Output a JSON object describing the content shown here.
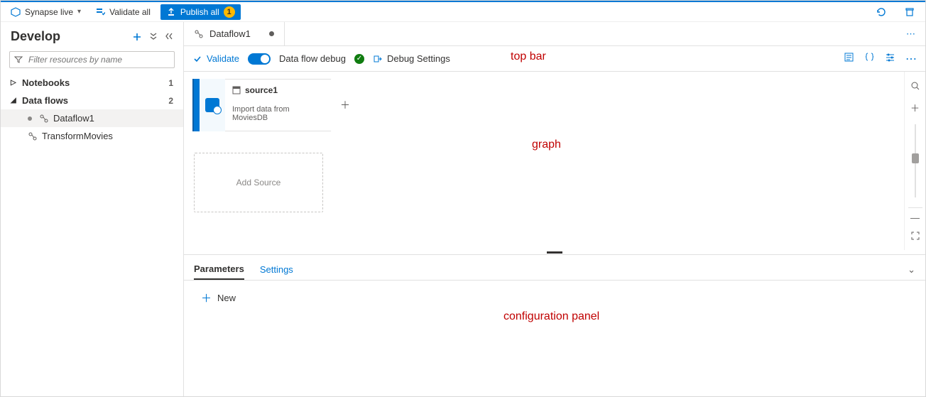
{
  "commandBar": {
    "branding": "Synapse live",
    "validateAll": "Validate all",
    "publishAll": "Publish all",
    "publishCount": "1"
  },
  "sidebar": {
    "title": "Develop",
    "filterPlaceholder": "Filter resources by name",
    "groups": [
      {
        "label": "Notebooks",
        "count": "1",
        "expanded": false
      },
      {
        "label": "Data flows",
        "count": "2",
        "expanded": true
      }
    ],
    "items": [
      {
        "label": "Dataflow1",
        "active": true,
        "modified": true
      },
      {
        "label": "TransformMovies",
        "active": false,
        "modified": false
      }
    ]
  },
  "tab": {
    "label": "Dataflow1"
  },
  "toolbar": {
    "validate": "Validate",
    "debugLabel": "Data flow debug",
    "debugSettings": "Debug Settings"
  },
  "graph": {
    "node": {
      "title": "source1",
      "subtitle": "Import data from MoviesDB"
    },
    "addSource": "Add Source"
  },
  "config": {
    "tabs": {
      "parameters": "Parameters",
      "settings": "Settings"
    },
    "newLabel": "New"
  },
  "annotations": {
    "topbar": "top bar",
    "graph": "graph",
    "config": "configuration panel"
  }
}
